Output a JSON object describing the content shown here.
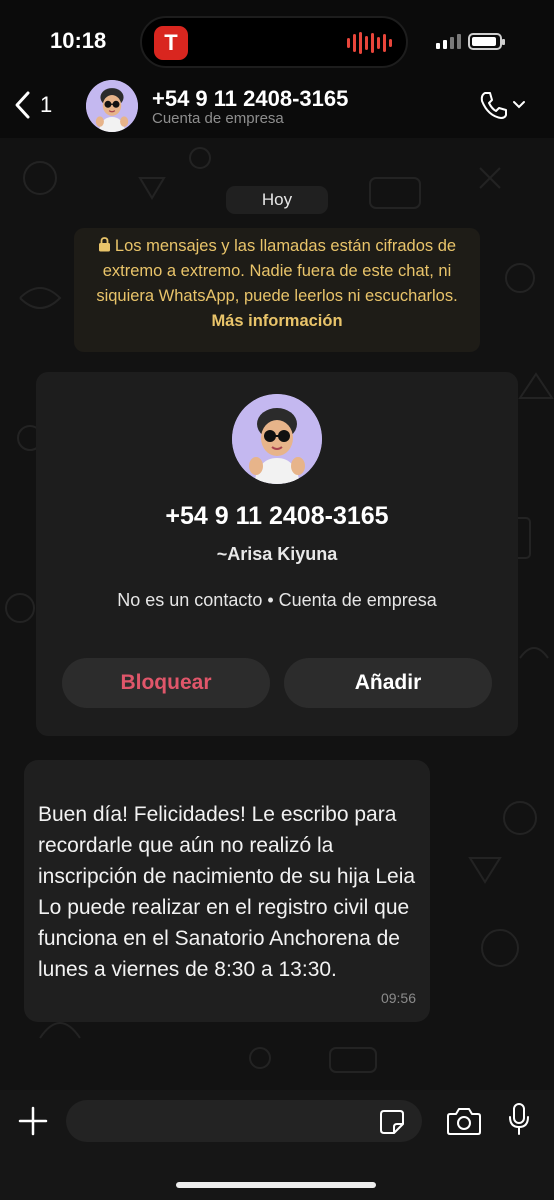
{
  "status_bar": {
    "time": "10:18",
    "island_app_letter": "T"
  },
  "header": {
    "back_count": "1",
    "contact_name": "+54 9 11 2408-3165",
    "subtitle": "Cuenta de empresa"
  },
  "chat": {
    "date_label": "Hoy",
    "encryption_notice": "Los mensajes y las llamadas están cifrados de extremo a extremo. Nadie fuera de este chat, ni siquiera WhatsApp, puede leerlos ni escucharlos.",
    "encryption_link": "Más información",
    "contact_card": {
      "phone": "+54 9 11 2408-3165",
      "name": "~Arisa Kiyuna",
      "info": "No es un contacto • Cuenta de empresa",
      "block_label": "Bloquear",
      "add_label": "Añadir"
    },
    "messages": [
      {
        "text": "Buen día! Felicidades! Le escribo para recordarle que aún no realizó la inscripción de nacimiento de su hija Leia\nLo puede realizar en el registro civil que funciona en el Sanatorio Anchorena de lunes a viernes de 8:30 a 13:30.",
        "time": "09:56"
      }
    ]
  },
  "input_bar": {
    "placeholder": ""
  },
  "colors": {
    "block_red": "#e0566a",
    "encryption_yellow": "#e9c46a",
    "island_red": "#d9261f"
  },
  "icons": [
    "back-chevron-icon",
    "phone-icon",
    "chevron-down-icon",
    "lock-icon",
    "plus-icon",
    "sticker-icon",
    "camera-icon",
    "microphone-icon"
  ]
}
